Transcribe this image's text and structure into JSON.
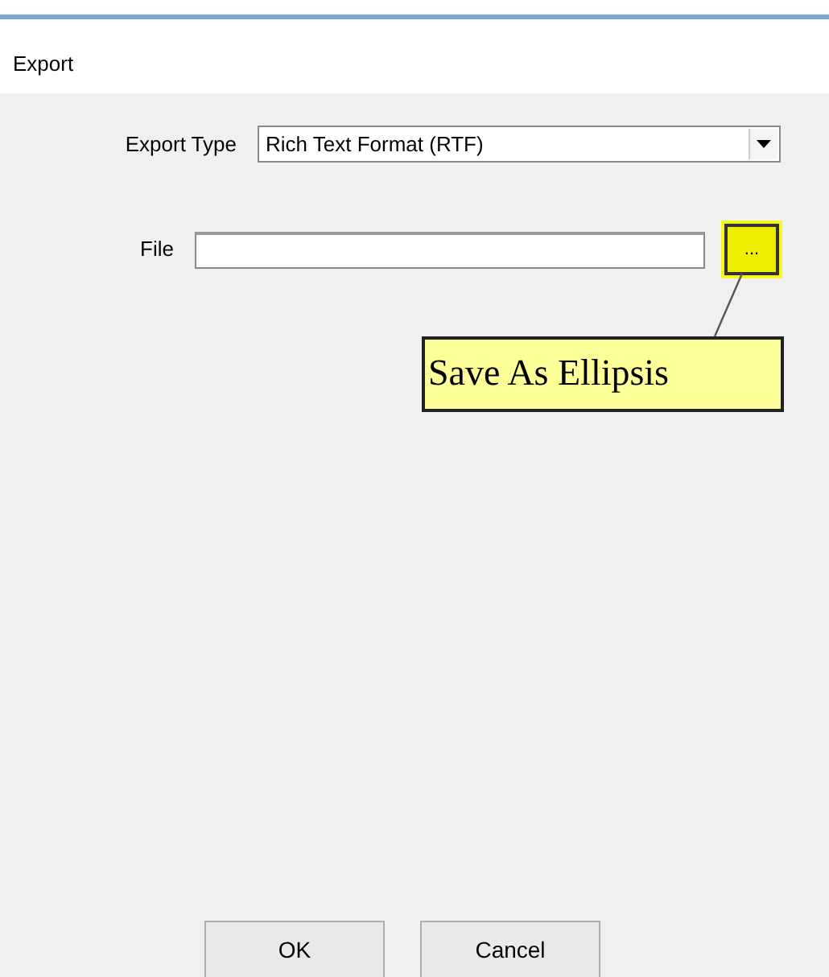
{
  "window": {
    "title": "Export"
  },
  "export_type": {
    "label": "Export Type",
    "value": "Rich Text Format (RTF)"
  },
  "file": {
    "label": "File",
    "browse_button": "...",
    "highlighted": true
  },
  "callout": {
    "text": "Save As Ellipsis"
  },
  "buttons": [
    "OK",
    "Cancel"
  ]
}
